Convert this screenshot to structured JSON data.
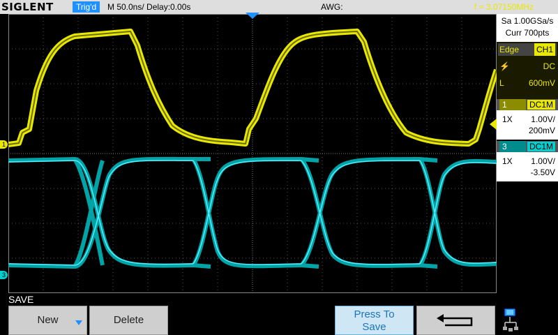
{
  "topbar": {
    "logo": "SIGLENT",
    "trig_status": "Trig'd",
    "timebase": "M 50.0ns/  Delay:0.00s",
    "awg": "AWG:",
    "frequency": "f = 3.07150MHz"
  },
  "right_panel": {
    "sample_rate": "Sa 1.00GSa/s",
    "curr_points": "Curr 700pts",
    "trigger": {
      "type": "Edge",
      "source": "CH1",
      "slope_icon": "rising-edge-icon",
      "coupling": "DC",
      "level_label": "L",
      "level": "600mV"
    },
    "channels": [
      {
        "number": "1",
        "coupling": "DC1M",
        "probe": "1X",
        "scale": "1.00V/",
        "offset": "200mV",
        "color": "#e8e800"
      },
      {
        "number": "3",
        "coupling": "DC1M",
        "probe": "1X",
        "scale": "1.00V/",
        "offset": "-3.50V",
        "color": "#00cfd0"
      }
    ]
  },
  "markers": {
    "ch1": "1",
    "ch3": "3"
  },
  "menu": {
    "title": "SAVE",
    "new_label": "New",
    "delete_label": "Delete",
    "press_to_save_line1": "Press To",
    "press_to_save_line2": "Save",
    "back_icon": "return-arrow-icon",
    "network_icon": "network-icon"
  },
  "colors": {
    "ch1": "#e8e800",
    "ch3": "#00cfd0",
    "accent": "#1e90ff"
  }
}
